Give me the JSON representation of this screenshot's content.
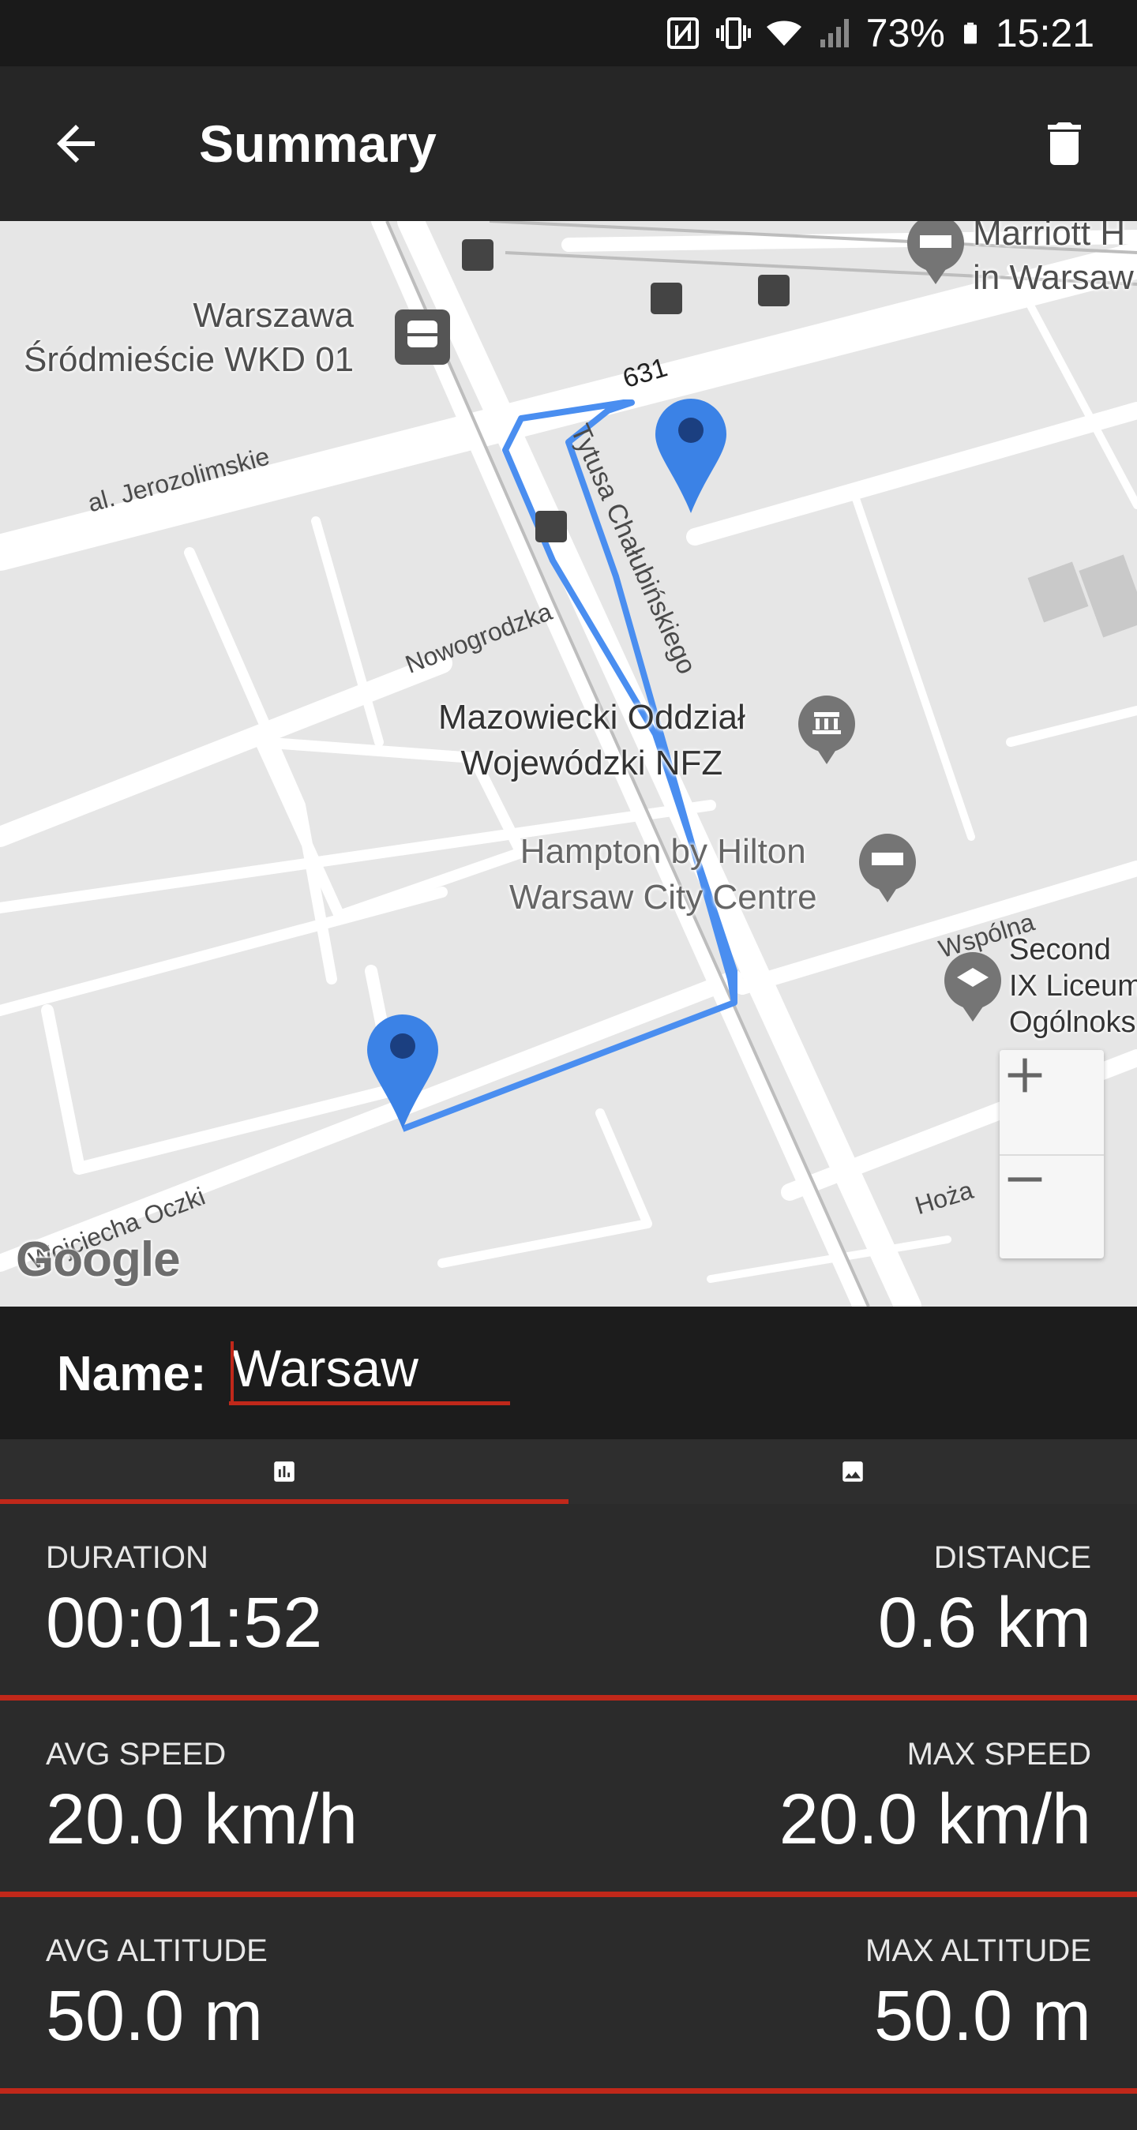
{
  "status_bar": {
    "battery": "73%",
    "time": "15:21",
    "icons": [
      "nfc-icon",
      "vibrate-icon",
      "wifi-icon",
      "signal-icon",
      "battery-icon"
    ]
  },
  "app_bar": {
    "title": "Summary",
    "back_icon": "arrow-left-icon",
    "delete_icon": "trash-icon"
  },
  "map": {
    "places": [
      {
        "name": "Warszawa\nŚródmieście WKD 01",
        "icon": "train-icon"
      },
      {
        "name": "Marriott H\nin Warsaw",
        "icon": "hotel-icon"
      },
      {
        "name": "Mazowiecki Oddział\nWojewódzki NFZ",
        "icon": "government-icon"
      },
      {
        "name": "Hampton by Hilton\nWarsaw City Centre",
        "icon": "hotel-icon"
      },
      {
        "name": "Second\nIX Liceum\nOgólnoks",
        "icon": "school-icon"
      }
    ],
    "roads": {
      "jerozolimskie": "al. Jerozolimskie",
      "chalubinskiego": "Tytusa Chałubińskiego",
      "nowogrodzka": "Nowogrodzka",
      "wspolna": "Wspólna",
      "hoza": "Hoża",
      "oczki": "Wojciecha Oczki",
      "route_number": "631"
    },
    "zoom_in": "+",
    "zoom_out": "−",
    "attribution": "Google",
    "route_color": "#4a8ef0",
    "marker_color": "#3b82e6"
  },
  "name_field": {
    "label": "Name:",
    "value": "Warsaw"
  },
  "tabs": [
    {
      "icon": "bar-chart-icon",
      "selected": true
    },
    {
      "icon": "image-icon",
      "selected": false
    }
  ],
  "stats": [
    {
      "left_label": "DURATION",
      "left_value": "00:01:52",
      "right_label": "DISTANCE",
      "right_value": "0.6 km"
    },
    {
      "left_label": "AVG SPEED",
      "left_value": "20.0 km/h",
      "right_label": "MAX SPEED",
      "right_value": "20.0 km/h"
    },
    {
      "left_label": "AVG ALTITUDE",
      "left_value": "50.0 m",
      "right_label": "MAX ALTITUDE",
      "right_value": "50.0 m"
    }
  ],
  "colors": {
    "accent": "#c0281a",
    "background": "#2b2b2b",
    "app_bar": "#262626"
  }
}
